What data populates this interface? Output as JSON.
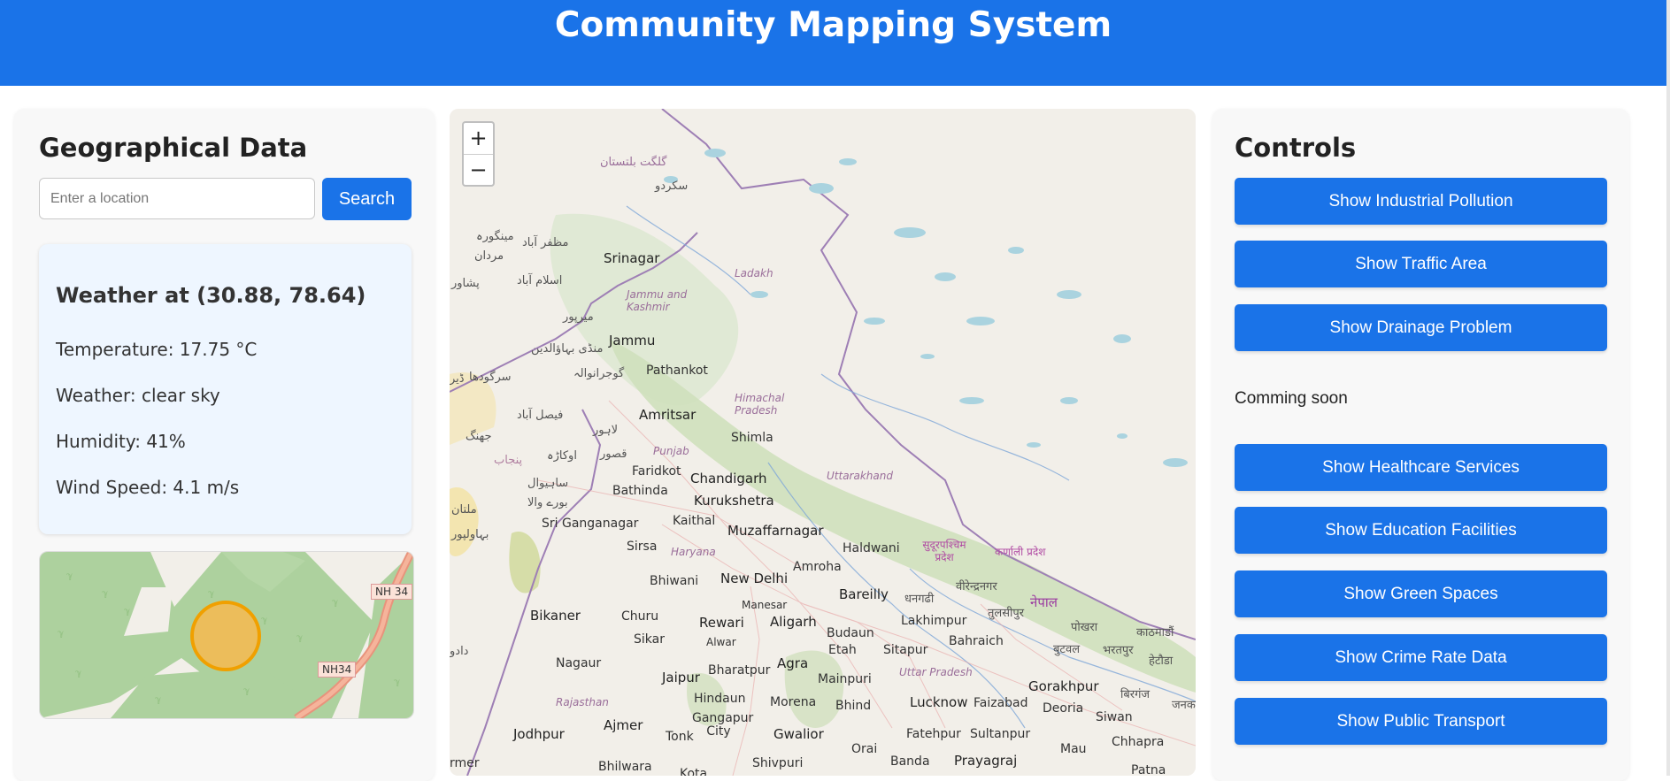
{
  "header": {
    "title": "Community Mapping System"
  },
  "left_panel": {
    "heading": "Geographical Data",
    "search": {
      "placeholder": "Enter a location",
      "value": "",
      "button_label": "Search"
    },
    "weather": {
      "title": "Weather at (30.88, 78.64)",
      "temperature": "Temperature: 17.75 °C",
      "condition": "Weather: clear sky",
      "humidity": "Humidity: 41%",
      "wind": "Wind Speed: 4.1 m/s"
    },
    "mini_map": {
      "road_label_1": "NH 34",
      "road_label_2": "NH34"
    }
  },
  "map": {
    "zoom_in": "+",
    "zoom_out": "−",
    "labels": {
      "gilgit": "گلگت بلتستان",
      "skardu": "سکردو",
      "mingora": "مینگورہ",
      "muzaffarabad": "مظفر آباد",
      "mardan": "مردان",
      "peshawar": "پشاور",
      "islamabad": "اسلام آباد",
      "mirpur": "میرپور",
      "mandi": "منڈی بہاؤالدین",
      "sargodha": "سرگودھا",
      "gujranwala": "گوجرانوالہ",
      "dera": "ڈیر",
      "faisalabad": "فیصل آباد",
      "lahore": "لاہور",
      "jhang": "جھنگ",
      "okara": "اوکاڑہ",
      "punjab_ur": "پنجاب",
      "kasur": "قصور",
      "sahiwal": "ساہیوال",
      "burewala": "بورے والا",
      "multan": "ملتان",
      "bahawalpur": "بہاولپور",
      "srinagar": "Srinagar",
      "jk": "Jammu and Kashmir",
      "ladakh": "Ladakh",
      "jammu": "Jammu",
      "pathankot": "Pathankot",
      "amritsar": "Amritsar",
      "himachal": "Himachal Pradesh",
      "shimla": "Shimla",
      "punjab": "Punjab",
      "faridkot": "Faridkot",
      "chandigarh": "Chandigarh",
      "bathinda": "Bathinda",
      "kurukshetra": "Kurukshetra",
      "uttarakhand": "Uttarakhand",
      "sriganganagar": "Sri Ganganagar",
      "kaithal": "Kaithal",
      "muzaffarnagar": "Muzaffarnagar",
      "haldwani": "Haldwani",
      "sudurpashchim": "सुदूरपश्चिम प्रदेश",
      "karnali": "कर्णाली प्रदेश",
      "sirsa": "Sirsa",
      "haryana": "Haryana",
      "amroha": "Amroha",
      "bhiwani": "Bhiwani",
      "newdelhi": "New Delhi",
      "manesar": "Manesar",
      "bareilly": "Bareilly",
      "dhangadhi": "धनगढी",
      "birendranagar": "वीरेन्द्रनगर",
      "tulsipur": "तुलसीपुर",
      "nepal": "नेपाल",
      "bikaner": "Bikaner",
      "churu": "Churu",
      "rewari": "Rewari",
      "aligarh": "Aligarh",
      "lakhimpur": "Lakhimpur",
      "pokhara": "पोखरा",
      "kathmandu": "काठमाडौं",
      "sikar": "Sikar",
      "alwar": "Alwar",
      "budaun": "Budaun",
      "bahraich": "Bahraich",
      "butwal": "बुटवल",
      "bharatpur_np": "भरतपुर",
      "hetauda": "हेटौडा",
      "nagaur": "Nagaur",
      "etah": "Etah",
      "sitapur": "Sitapur",
      "bharatpur": "Bharatpur",
      "agra": "Agra",
      "jaipur": "Jaipur",
      "mainpuri": "Mainpuri",
      "uttarpradesh": "Uttar Pradesh",
      "gorakhpur": "Gorakhpur",
      "birgunj": "बिरगंज",
      "rajasthan": "Rajasthan",
      "hindaun": "Hindaun",
      "morena": "Morena",
      "bhind": "Bhind",
      "lucknow": "Lucknow",
      "faizabad": "Faizabad",
      "deoria": "Deoria",
      "siwan": "Siwan",
      "janak": "जनक",
      "ajmer": "Ajmer",
      "gangapur": "Gangapur City",
      "jodhpur": "Jodhpur",
      "tonk": "Tonk",
      "gwalior": "Gwalior",
      "fatehpur": "Fatehpur",
      "sultanpur": "Sultanpur",
      "chhapra": "Chhapra",
      "orai": "Orai",
      "banda": "Banda",
      "prayagraj": "Prayagraj",
      "mau": "Mau",
      "patna": "Patna",
      "shivpuri": "Shivpuri",
      "bhilwara": "Bhilwara",
      "kota": "Kota",
      "barmer": "rmer",
      "dadu": "دادو"
    }
  },
  "controls": {
    "heading": "Controls",
    "buttons_top": [
      "Show Industrial Pollution",
      "Show Traffic Area",
      "Show Drainage Problem"
    ],
    "coming_soon": "Comming soon",
    "buttons_bottom": [
      "Show Healthcare Services",
      "Show Education Facilities",
      "Show Green Spaces",
      "Show Crime Rate Data",
      "Show Public Transport"
    ]
  },
  "colors": {
    "primary": "#1a73e8",
    "map_land": "#f2efe9",
    "map_forest": "#add19e",
    "map_water": "#aad3df",
    "border": "#9e7fb5",
    "marker_fill": "#fbb84a",
    "marker_stroke": "#f0a000"
  }
}
